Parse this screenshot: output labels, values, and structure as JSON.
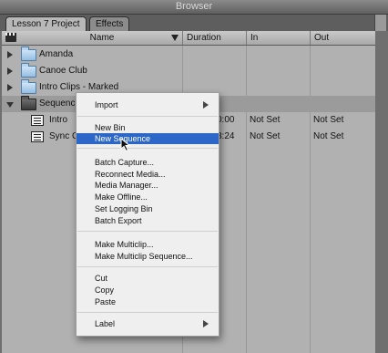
{
  "window": {
    "title": "Browser"
  },
  "tabs": [
    {
      "label": "Lesson 7 Project",
      "active": true
    },
    {
      "label": "Effects",
      "active": false
    }
  ],
  "columns": {
    "name": "Name",
    "duration": "Duration",
    "in": "In",
    "out": "Out"
  },
  "rows": [
    {
      "name": "Amanda",
      "icon": "folder-icon"
    },
    {
      "name": "Canoe Club",
      "icon": "folder-icon"
    },
    {
      "name": "Intro Clips - Marked",
      "icon": "folder-icon"
    },
    {
      "name": "Sequences",
      "icon": "folder-icon",
      "expanded": true
    },
    {
      "name": "Intro",
      "icon": "sequence-icon",
      "duration": "0:00",
      "in": "Not Set",
      "out": "Not Set"
    },
    {
      "name": "Sync C",
      "icon": "sequence-icon",
      "duration": "3:24",
      "in": "Not Set",
      "out": "Not Set"
    }
  ],
  "context_menu": {
    "import": "Import",
    "new_bin": "New Bin",
    "new_sequence": "New Sequence",
    "batch_capture": "Batch Capture...",
    "reconnect_media": "Reconnect Media...",
    "media_manager": "Media Manager...",
    "make_offline": "Make Offline...",
    "set_logging_bin": "Set Logging Bin",
    "batch_export": "Batch Export",
    "make_multiclip": "Make Multiclip...",
    "make_multiclip_sequence": "Make Multiclip Sequence...",
    "cut": "Cut",
    "copy": "Copy",
    "paste": "Paste",
    "label": "Label"
  },
  "colors": {
    "selection": "#2c67c7",
    "folder": "#95bde2"
  }
}
